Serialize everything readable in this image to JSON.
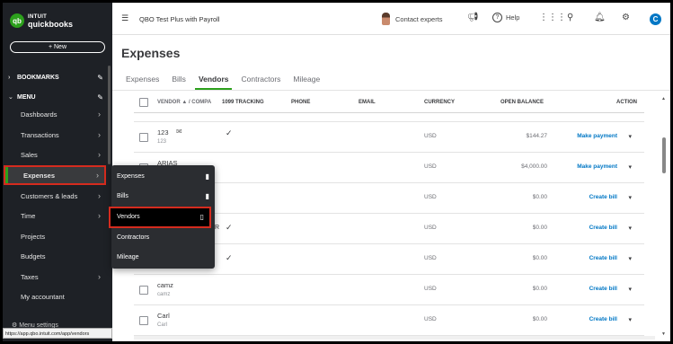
{
  "app": {
    "logo_top": "INTUIT",
    "logo_bottom": "quickbooks",
    "logo_mark": "qb",
    "company": "QBO Test Plus with Payroll",
    "contact": "Contact experts",
    "help": "Help",
    "user_initial": "C"
  },
  "sidebar": {
    "new_button": "+ New",
    "bookmarks": "BOOKMARKS",
    "menu": "MENU",
    "items": [
      {
        "label": "Dashboards",
        "arrow": "›"
      },
      {
        "label": "Transactions",
        "arrow": "›"
      },
      {
        "label": "Sales",
        "arrow": "›"
      },
      {
        "label": "Expenses",
        "arrow": "›"
      },
      {
        "label": "Customers & leads",
        "arrow": "›"
      },
      {
        "label": "Time",
        "arrow": "›"
      },
      {
        "label": "Projects",
        "arrow": ""
      },
      {
        "label": "Budgets",
        "arrow": ""
      },
      {
        "label": "Taxes",
        "arrow": "›"
      },
      {
        "label": "My accountant",
        "arrow": ""
      }
    ],
    "menu_settings": "Menu settings",
    "status_url": "https://app.qbo.intuit.com/app/vendors"
  },
  "flyout": {
    "items": [
      "Expenses",
      "Bills",
      "Vendors",
      "Contractors",
      "Mileage"
    ]
  },
  "page": {
    "title": "Expenses",
    "tabs": [
      "Expenses",
      "Bills",
      "Vendors",
      "Contractors",
      "Mileage"
    ]
  },
  "table": {
    "headers": {
      "vendor": "VENDOR ▲ / COMPA",
      "tracking": "1099 TRACKING",
      "phone": "PHONE",
      "email": "EMAIL",
      "currency": "CURRENCY",
      "balance": "OPEN BALANCE",
      "action": "ACTION"
    },
    "rows": [
      {
        "name": "123",
        "sub": "123",
        "currency": "USD",
        "balance": "$144.27",
        "action": "Make payment"
      },
      {
        "name": "ARIAS",
        "sub": "",
        "currency": "USD",
        "balance": "$4,000.00",
        "action": "Make payment"
      },
      {
        "name": "",
        "sub": "",
        "currency": "USD",
        "balance": "$0.00",
        "action": "Create bill"
      },
      {
        "name": "",
        "sub": "",
        "currency": "USD",
        "balance": "$0.00",
        "action": "Create bill"
      },
      {
        "name": "",
        "sub": "",
        "currency": "USD",
        "balance": "$0.00",
        "action": "Create bill"
      },
      {
        "name": "camz",
        "sub": "camz",
        "currency": "USD",
        "balance": "$0.00",
        "action": "Create bill"
      },
      {
        "name": "Carl",
        "sub": "Carl",
        "currency": "USD",
        "balance": "$0.00",
        "action": "Create bill"
      }
    ],
    "partial_text": "R"
  },
  "icons": {
    "menu": "☰",
    "bookmark": "🔖",
    "pencil": "✎",
    "check": "✓",
    "caret": "▾",
    "mail": "✉"
  }
}
